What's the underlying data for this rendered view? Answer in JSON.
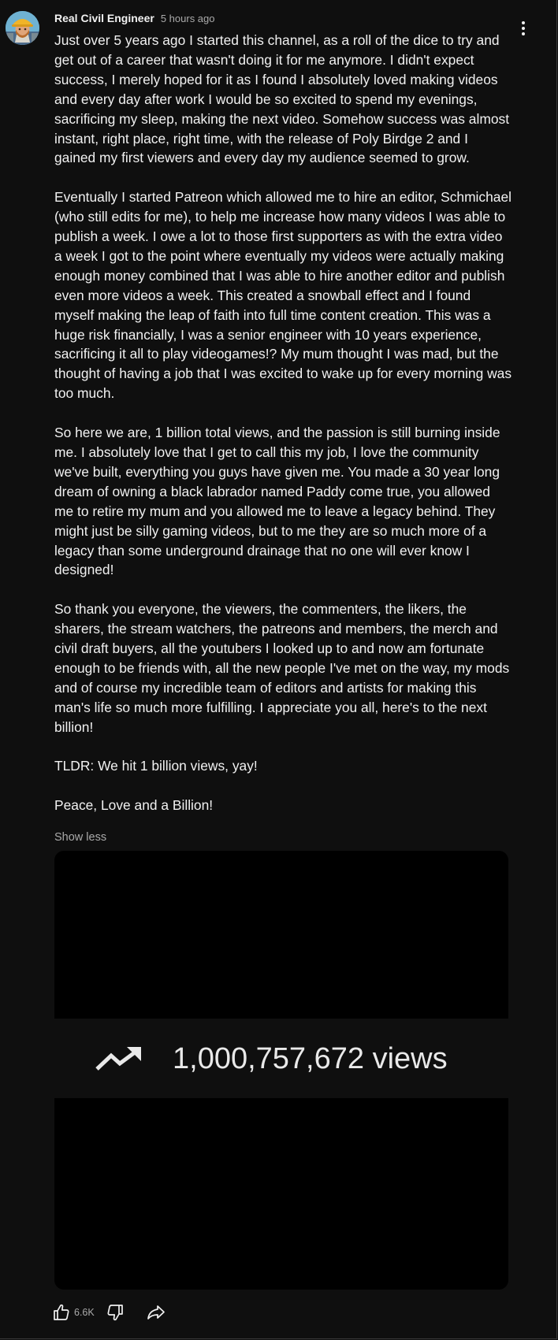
{
  "post": {
    "author": "Real Civil Engineer",
    "time": "5 hours ago",
    "paragraphs": [
      "Just over 5 years ago I started this channel, as a roll of the dice to try and get out of a career that wasn't doing it for me anymore. I didn't expect success, I merely hoped for it as I found I absolutely loved making videos and every day after work I would be so excited to spend my evenings, sacrificing my sleep, making the next video. Somehow success was almost instant, right place, right time, with the release of Poly Birdge 2 and I gained my first viewers and every day my audience seemed to grow.",
      "Eventually I started Patreon which allowed me to hire an editor, Schmichael (who still edits for me), to help me increase how many videos I was able to publish a week. I owe a lot to those first supporters as with the extra video a week I got to the point where eventually my videos were actually making enough money combined that I was able to hire another editor and publish even more videos a week. This created a snowball effect and I found myself making the leap of faith into full time content creation. This was a huge risk financially, I was a senior engineer with 10 years experience, sacrificing it all to play videogames!? My mum thought I was mad, but the thought of having a job that I was excited to wake up for every morning was too much.",
      "So here we are, 1 billion total views, and the passion is still burning inside me. I absolutely love that I get to call this my job, I love the community we've built, everything you guys have given me. You made a 30 year long dream of owning a black labrador named Paddy come true, you allowed me to retire my mum and you allowed me to leave a legacy behind. They might just be silly gaming videos, but to me they are so much more of a legacy than some underground drainage that no one will ever know I designed!",
      "So thank you everyone, the viewers, the commenters, the likers, the sharers, the stream watchers, the patreons and members, the merch and civil draft buyers, all the youtubers I looked up to and now am fortunate enough to be friends with, all the new people I've met on the way, my mods and of course my incredible team of editors and artists for making this man's life so much more fulfilling. I appreciate you all, here's to the next billion!",
      "TLDR: We hit 1 billion views, yay!",
      "Peace, Love and a Billion!"
    ],
    "show_less": "Show less",
    "image": {
      "views_text": "1,000,757,672 views",
      "icon": "trending-up-icon"
    },
    "actions": {
      "like_count": "6.6K",
      "like_icon": "thumbs-up-icon",
      "dislike_icon": "thumbs-down-icon",
      "share_icon": "share-icon"
    },
    "menu_icon": "more-vert-icon"
  },
  "colors": {
    "background": "#0f0f0f",
    "text": "#f1f1f1",
    "secondary_text": "#aaaaaa",
    "image_background": "#000000"
  }
}
